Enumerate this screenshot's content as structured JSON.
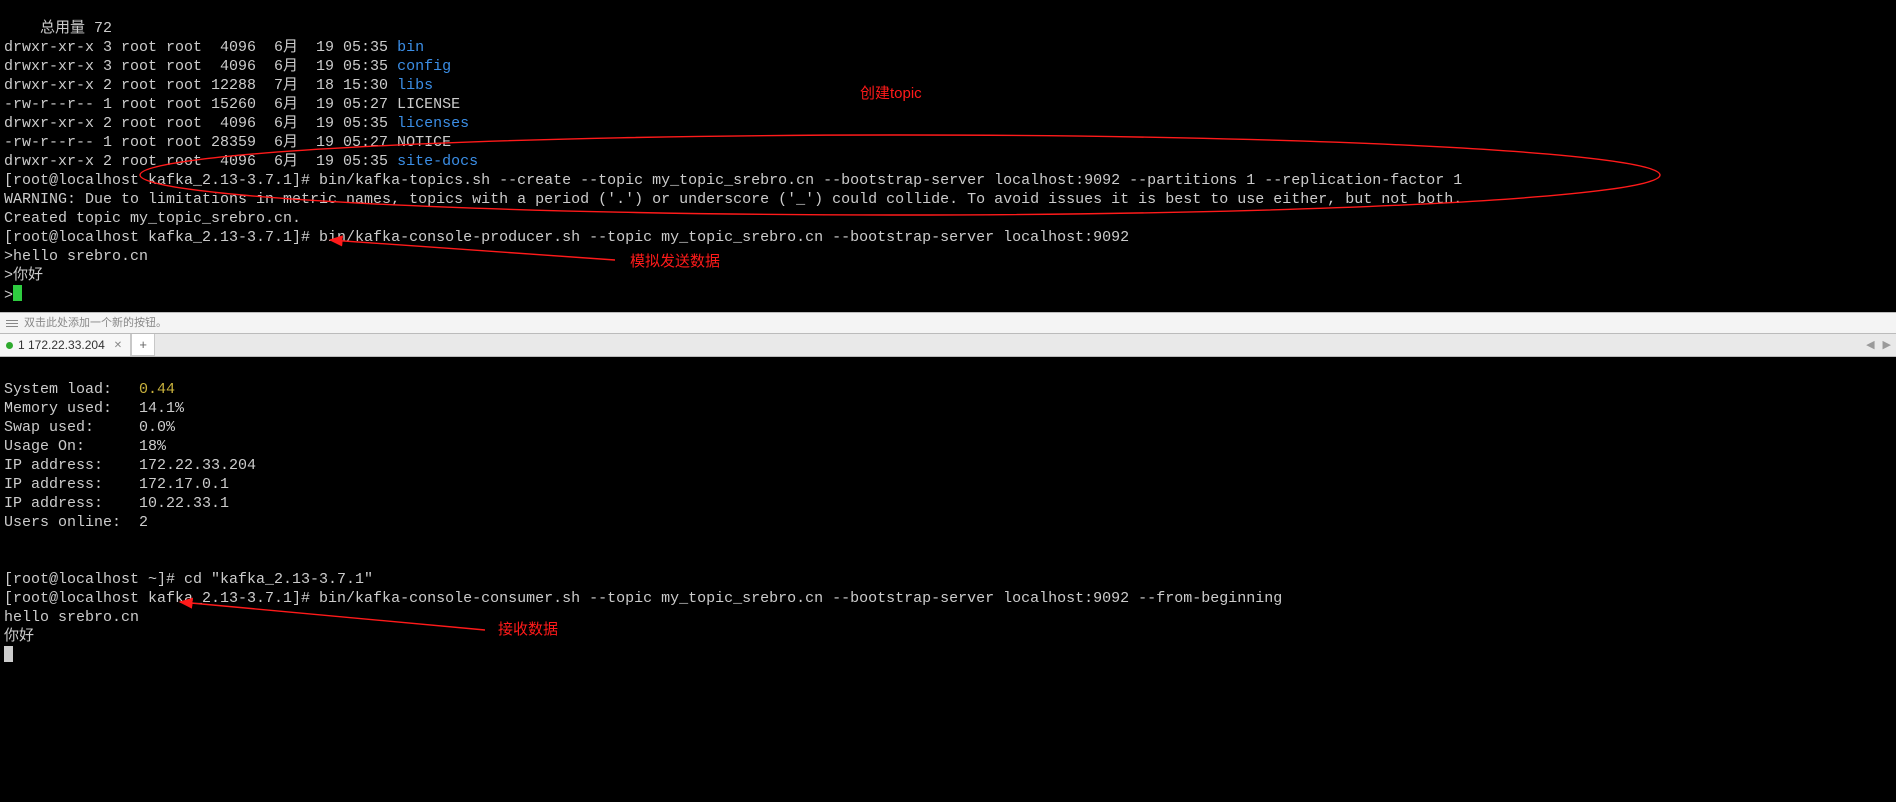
{
  "annotations": {
    "create_topic": "创建topic",
    "send_data": "模拟发送数据",
    "recv_data": "接收数据"
  },
  "toolbar": {
    "hint": "双击此处添加一个新的按钮。"
  },
  "tab": {
    "label": "1 172.22.33.204",
    "add": "+"
  },
  "top": {
    "l0": "总用量 72",
    "l1a": "drwxr-xr-x 3 root root  4096  6月  19 05:35 ",
    "l1b": "bin",
    "l2a": "drwxr-xr-x 3 root root  4096  6月  19 05:35 ",
    "l2b": "config",
    "l3a": "drwxr-xr-x 2 root root 12288  7月  18 15:30 ",
    "l3b": "libs",
    "l4": "-rw-r--r-- 1 root root 15260  6月  19 05:27 LICENSE",
    "l5a": "drwxr-xr-x 2 root root  4096  6月  19 05:35 ",
    "l5b": "licenses",
    "l6": "-rw-r--r-- 1 root root 28359  6月  19 05:27 NOTICE",
    "l7a": "drwxr-xr-x 2 root root  4096  6月  19 05:35 ",
    "l7b": "site-docs",
    "l8": "[root@localhost kafka_2.13-3.7.1]# bin/kafka-topics.sh --create --topic my_topic_srebro.cn --bootstrap-server localhost:9092 --partitions 1 --replication-factor 1",
    "l9": "WARNING: Due to limitations in metric names, topics with a period ('.') or underscore ('_') could collide. To avoid issues it is best to use either, but not both.",
    "l10": "Created topic my_topic_srebro.cn.",
    "l11": "[root@localhost kafka_2.13-3.7.1]# bin/kafka-console-producer.sh --topic my_topic_srebro.cn --bootstrap-server localhost:9092",
    "l12": ">hello srebro.cn",
    "l13": ">你好",
    "l14": ">"
  },
  "bottom": {
    "sys_load_k": "System load:   ",
    "sys_load_v": "0.44",
    "mem_k": "Memory used:   ",
    "mem_v": "14.1%",
    "swap_k": "Swap used:     ",
    "swap_v": "0.0%",
    "usage_k": "Usage On:      ",
    "usage_v": "18%",
    "ip1_k": "IP address:    ",
    "ip1_v": "172.22.33.204",
    "ip2_k": "IP address:    ",
    "ip2_v": "172.17.0.1",
    "ip3_k": "IP address:    ",
    "ip3_v": "10.22.33.1",
    "users_k": "Users online:  ",
    "users_v": "2",
    "blank": "",
    "cmd1": "[root@localhost ~]# cd \"kafka_2.13-3.7.1\"",
    "cmd2": "[root@localhost kafka_2.13-3.7.1]# bin/kafka-console-consumer.sh --topic my_topic_srebro.cn --bootstrap-server localhost:9092 --from-beginning",
    "out1": "hello srebro.cn",
    "out2": "你好"
  }
}
